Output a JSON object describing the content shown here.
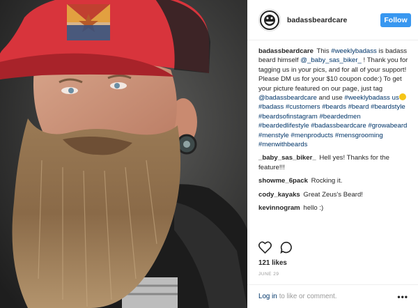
{
  "post": {
    "username": "badassbeardcare",
    "follow_label": "Follow",
    "caption": {
      "user": "badassbeardcare",
      "segments": [
        {
          "text": " This ",
          "tag": false
        },
        {
          "text": "#weeklybadass",
          "tag": true
        },
        {
          "text": " is badass beard himself ",
          "tag": false
        },
        {
          "text": "@_baby_sas_biker_",
          "tag": true
        },
        {
          "text": " ! Thank you for tagging us in your pics, and for all of your support! Please DM us for your $10 coupon code:) To get your picture featured on our page, just tag ",
          "tag": false
        },
        {
          "text": "@badassbeardcare",
          "tag": true
        },
        {
          "text": " and use ",
          "tag": false
        },
        {
          "text": "#weeklybadass",
          "tag": true
        },
        {
          "text": " us",
          "tag": false
        }
      ],
      "hashtags": [
        "#badass",
        "#customers",
        "#beards",
        "#beard",
        "#beardstyle",
        "#beardsofinstagram",
        "#beardedmen",
        "#beardedlifestyle",
        "#badassbeardcare",
        "#growabeard",
        "#menstyle",
        "#menproducts",
        "#mensgrooming",
        "#menwithbeards"
      ]
    },
    "comments": [
      {
        "user": "_baby_sas_biker_",
        "text": "Hell yes! Thanks for the feature!!!"
      },
      {
        "user": "showme_6pack",
        "text": "Rocking it."
      },
      {
        "user": "cody_kayaks",
        "text": "Great Zeus's Beard!"
      },
      {
        "user": "kevinnogram",
        "text": "hello :)"
      }
    ],
    "likes": "121 likes",
    "date": "JUNE 29",
    "footer": {
      "login": "Log in",
      "rest": "to like or comment.",
      "more": "•••"
    }
  },
  "icons": {
    "like": "heart-outline-icon",
    "comment": "comment-bubble-icon",
    "more": "more-options-icon"
  },
  "colors": {
    "accent": "#3897f0",
    "link": "#003569",
    "text": "#262626",
    "muted": "#999999",
    "hat_red": "#d8343c"
  }
}
